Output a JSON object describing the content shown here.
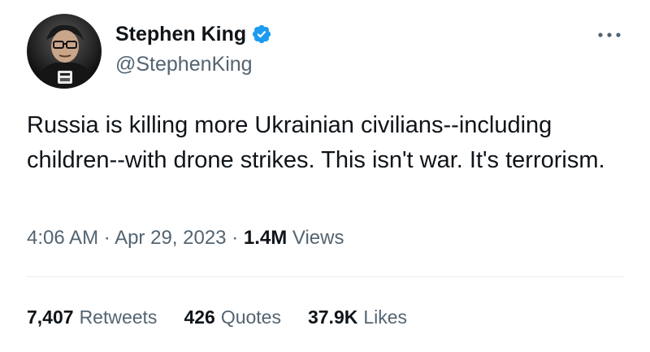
{
  "author": {
    "display_name": "Stephen King",
    "handle": "@StephenKing",
    "verified": true,
    "verified_icon": "verified-badge-icon",
    "avatar_icon": "profile-photo"
  },
  "tweet": {
    "text": "Russia is killing more Ukrainian civilians--including children--with drone strikes. This isn't war. It's terrorism."
  },
  "meta": {
    "time": "4:06 AM",
    "separator": "·",
    "date": "Apr 29, 2023",
    "views_count": "1.4M",
    "views_label": "Views"
  },
  "stats": {
    "retweets_count": "7,407",
    "retweets_label": "Retweets",
    "quotes_count": "426",
    "quotes_label": "Quotes",
    "likes_count": "37.9K",
    "likes_label": "Likes"
  },
  "colors": {
    "text_primary": "#0f1419",
    "text_secondary": "#536471",
    "verified_blue": "#1d9bf0",
    "divider": "#e6ecf0",
    "background": "#ffffff"
  },
  "more_icon": "more-options-icon"
}
